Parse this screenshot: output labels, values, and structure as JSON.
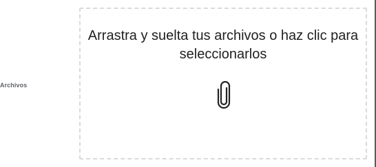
{
  "form": {
    "field_label": "Archivos"
  },
  "dropzone": {
    "instruction": "Arrastra y suelta tus archivos o haz clic para seleccionarlos",
    "icon": "paperclip-icon"
  },
  "colors": {
    "border_dash": "#dadada",
    "text": "#1f1f1f",
    "label": "#5f6368"
  }
}
